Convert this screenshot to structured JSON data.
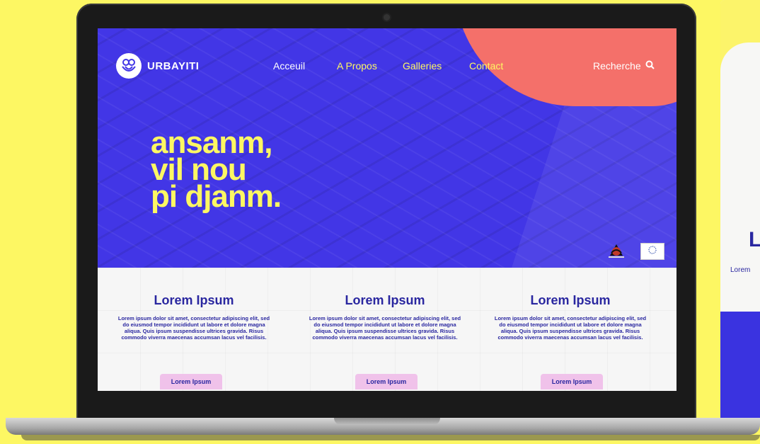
{
  "site": {
    "brand": "URBAYITI",
    "nav": [
      {
        "label": "Acceuil"
      },
      {
        "label": "A Propos"
      },
      {
        "label": "Galleries"
      },
      {
        "label": "Contact"
      }
    ],
    "search_label": "Recherche",
    "headline": [
      "ansanm,",
      "vil nou",
      "pi djanm."
    ]
  },
  "sections": [
    {
      "title": "Lorem Ipsum",
      "text": "Lorem ipsum dolor sit amet, consectetur adipiscing elit, sed do eiusmod tempor incididunt ut labore et dolore magna aliqua. Quis ipsum suspendisse ultrices gravida. Risus commodo viverra maecenas accumsan lacus vel facilisis.",
      "button": "Lorem Ipsum"
    },
    {
      "title": "Lorem Ipsum",
      "text": "Lorem ipsum dolor sit amet, consectetur adipiscing elit, sed do eiusmod tempor incididunt ut labore et dolore magna aliqua. Quis ipsum suspendisse ultrices gravida. Risus commodo viverra maecenas accumsan lacus vel facilisis.",
      "button": "Lorem Ipsum"
    },
    {
      "title": "Lorem Ipsum",
      "text": "Lorem ipsum dolor sit amet, consectetur adipiscing elit, sed do eiusmod tempor incididunt ut labore et dolore magna aliqua. Quis ipsum suspendisse ultrices gravida. Risus commodo viverra maecenas accumsan lacus vel facilisis.",
      "button": "Lorem Ipsum"
    }
  ],
  "peek": {
    "title": "L",
    "text": "Lorem"
  },
  "colors": {
    "background": "#fdf763",
    "hero_blue": "#4236e6",
    "accent_coral": "#f4706a",
    "headline_yellow": "#fdf763",
    "text_navy": "#2a27a0",
    "button_pink": "#f0c2ea"
  },
  "icons": [
    "urbayiti-logo-icon",
    "search-icon",
    "haiti-emblem-icon",
    "eu-flag-icon"
  ]
}
